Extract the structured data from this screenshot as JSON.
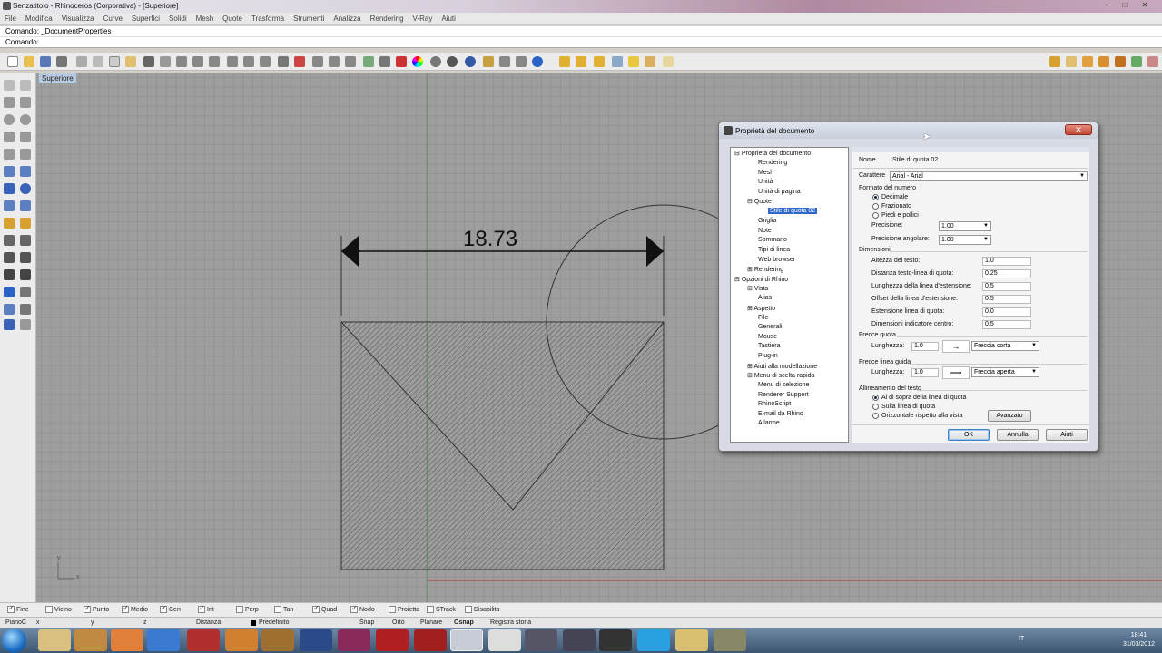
{
  "window": {
    "title": "Senzatitolo - Rhinoceros (Corporativa) - [Superiore]",
    "minimize": "–",
    "maximize": "□",
    "close": "✕"
  },
  "menu": [
    "File",
    "Modifica",
    "Visualizza",
    "Curve",
    "Superfici",
    "Solidi",
    "Mesh",
    "Quote",
    "Trasforma",
    "Strumenti",
    "Analizza",
    "Rendering",
    "V-Ray",
    "Aiuti"
  ],
  "command": {
    "history": "Comando: _DocumentProperties",
    "prompt": "Comando:"
  },
  "viewport": {
    "label": "Superiore",
    "dimension_text": "18.73",
    "axis_y": "y",
    "axis_x": "x"
  },
  "dialog": {
    "title": "Proprietà del documento",
    "close": "✕",
    "tree": [
      "Proprietà del documento",
      "Rendering",
      "Mesh",
      "Unità",
      "Unità di pagina",
      "Quote",
      "Stile di quota 02",
      "Griglia",
      "Note",
      "Sommario",
      "Tipi di linea",
      "Web browser",
      "Rendering",
      "Opzioni di Rhino",
      "Vista",
      "Alias",
      "Aspetto",
      "File",
      "Generali",
      "Mouse",
      "Tastiera",
      "Plug-in",
      "Aiuti alla modellazione",
      "Menu di scelta rapida",
      "Menu di selezione",
      "Renderer Support",
      "RhinoScript",
      "E-mail da Rhino",
      "Allarme"
    ],
    "name_label": "Nome",
    "name_value": "Stile di quota 02",
    "font_label": "Carattere",
    "font_value": "Arial - Arial",
    "number_format_label": "Formato del numero",
    "number_formats": [
      "Decimale",
      "Frazionato",
      "Piedi e pollici"
    ],
    "precision_label": "Precisione:",
    "precision_value": "1.00",
    "angle_precision_label": "Precisione angolare:",
    "angle_precision_value": "1.00",
    "dimensions_label": "Dimensioni",
    "dimension_rows": [
      {
        "label": "Altezza del testo:",
        "value": "1.0"
      },
      {
        "label": "Distanza testo-linea di quota:",
        "value": "0.25"
      },
      {
        "label": "Lunghezza della linea d'estensione:",
        "value": "0.5"
      },
      {
        "label": "Offset della linea d'estensione:",
        "value": "0.5"
      },
      {
        "label": "Estensione linea di quota:",
        "value": "0.0"
      },
      {
        "label": "Dimensioni indicatore centro:",
        "value": "0.5"
      }
    ],
    "arrows_label": "Frecce quota",
    "arrows_length_label": "Lunghezza:",
    "arrows_length_value": "1.0",
    "arrows_type": "Freccia corta",
    "leader_label": "Frecce linea guida",
    "leader_length_label": "Lunghezza:",
    "leader_length_value": "1.0",
    "leader_type": "Freccia aperta",
    "align_label": "Allineamento del testo",
    "align_options": [
      "Al di sopra della linea di quota",
      "Sulla linea di quota",
      "Orizzontale rispetto alla vista"
    ],
    "advanced_button": "Avanzato",
    "ok": "OK",
    "cancel": "Annulla",
    "help": "Aiuti"
  },
  "osnap": [
    {
      "label": "Fine",
      "checked": true
    },
    {
      "label": "Vicino",
      "checked": false
    },
    {
      "label": "Punto",
      "checked": true
    },
    {
      "label": "Medio",
      "checked": true
    },
    {
      "label": "Cen",
      "checked": true
    },
    {
      "label": "Int",
      "checked": true
    },
    {
      "label": "Perp",
      "checked": false
    },
    {
      "label": "Tan",
      "checked": false
    },
    {
      "label": "Quad",
      "checked": true
    },
    {
      "label": "Nodo",
      "checked": true
    },
    {
      "label": "Proietta",
      "checked": false
    },
    {
      "label": "STrack",
      "checked": false
    },
    {
      "label": "Disabilita",
      "checked": false
    }
  ],
  "status": {
    "cplane": "PianoC",
    "x": "x",
    "y": "y",
    "z": "z",
    "distance": "Distanza",
    "layer": "Predefinito",
    "snap": "Snap",
    "orto": "Orto",
    "planar": "Planare",
    "osnap": "Osnap",
    "history": "Registra storia"
  },
  "taskbar": {
    "lang": "IT",
    "time": "18:41",
    "date": "31/03/2012"
  },
  "colors": {
    "viewport_bg": "#9e9e9e",
    "green_axis": "#2f8a2f",
    "red_axis": "#a83232"
  }
}
